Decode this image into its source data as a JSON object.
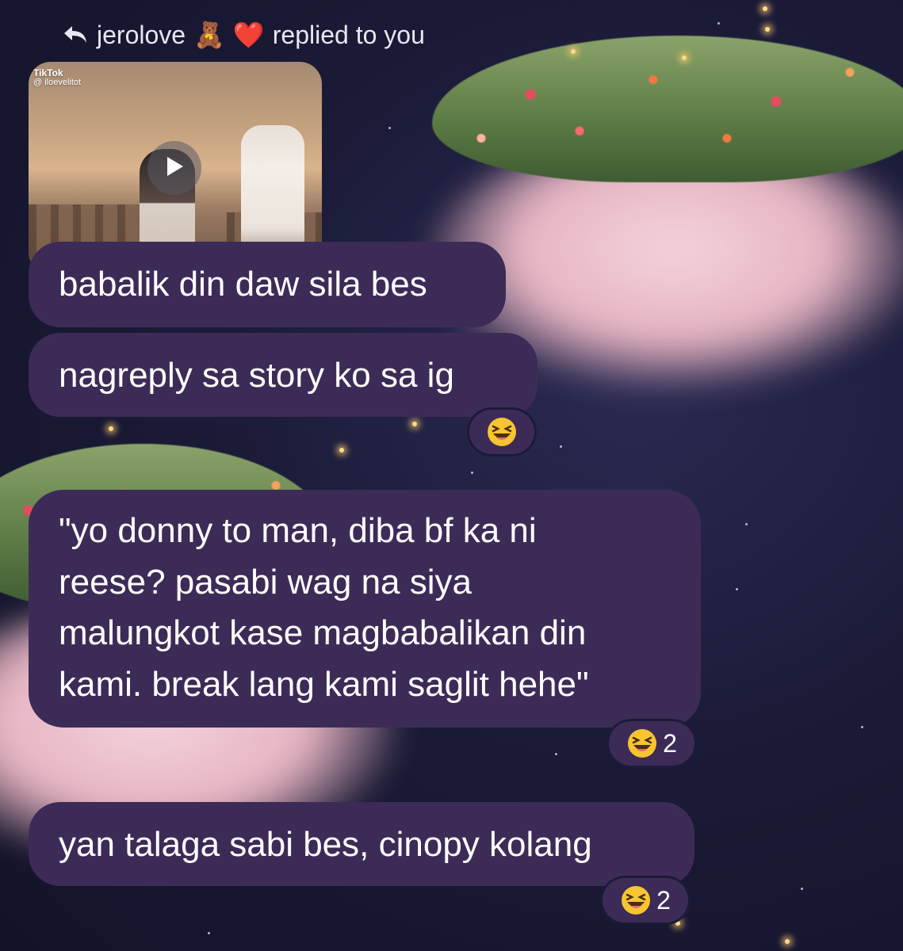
{
  "header": {
    "username": "jerolove",
    "emoji_1": "🧸",
    "emoji_2": "❤️",
    "suffix": "replied to you"
  },
  "media": {
    "brand": "TikTok",
    "handle": "@ iloevelitot"
  },
  "messages": [
    {
      "text": "babalik din daw sila bes"
    },
    {
      "text": "nagreply sa story ko sa ig",
      "reaction": {
        "emoji": "laughing-face",
        "count": ""
      }
    },
    {
      "lines": [
        "\"yo donny to man, diba bf ka ni",
        "reese? pasabi wag na siya",
        "malungkot kase magbabalikan din",
        "kami. break lang kami saglit hehe\""
      ],
      "reaction": {
        "emoji": "laughing-face",
        "count": "2"
      }
    },
    {
      "text": "yan talaga sabi bes, cinopy kolang",
      "reaction": {
        "emoji": "laughing-face",
        "count": "2"
      }
    }
  ],
  "colors": {
    "bubble": "#3d2b57",
    "background": "#16162e",
    "cloud": "#f0c9d4"
  }
}
